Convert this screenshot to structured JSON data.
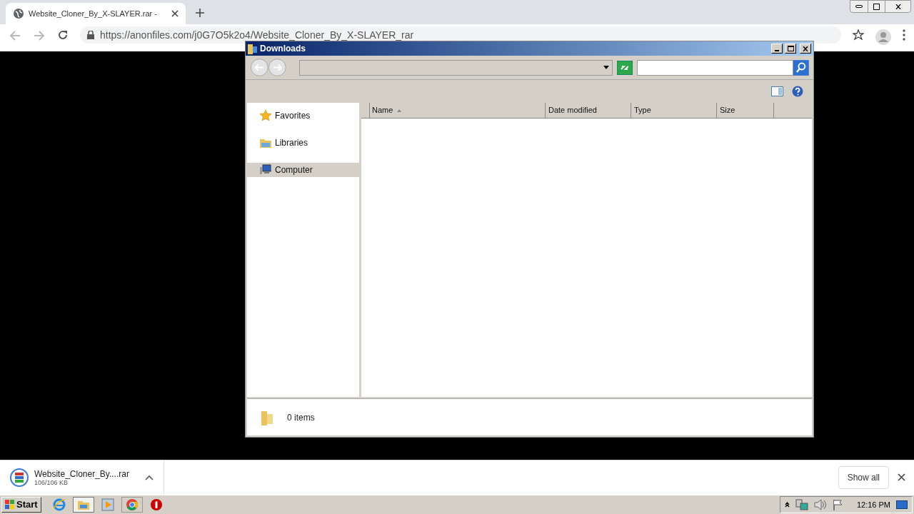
{
  "browser": {
    "tab": {
      "title": "Website_Cloner_By_X-SLAYER.rar -"
    },
    "address": "https://anonfiles.com/j0G7O5k2o4/Website_Cloner_By_X-SLAYER_rar"
  },
  "explorer": {
    "title": "Downloads",
    "nav_items": [
      {
        "label": "Favorites",
        "kind": "star",
        "selected": false
      },
      {
        "label": "Libraries",
        "kind": "library",
        "selected": false
      },
      {
        "label": "Computer",
        "kind": "computer",
        "selected": true
      }
    ],
    "columns": [
      {
        "label": "Name",
        "sorted": true
      },
      {
        "label": "Date modified",
        "sorted": false
      },
      {
        "label": "Type",
        "sorted": false
      },
      {
        "label": "Size",
        "sorted": false
      }
    ],
    "status": "0 items"
  },
  "download_bar": {
    "file": "Website_Cloner_By....rar",
    "size": "106/106 KB",
    "show_all": "Show all"
  },
  "taskbar": {
    "start": "Start",
    "clock": "12:16 PM"
  }
}
